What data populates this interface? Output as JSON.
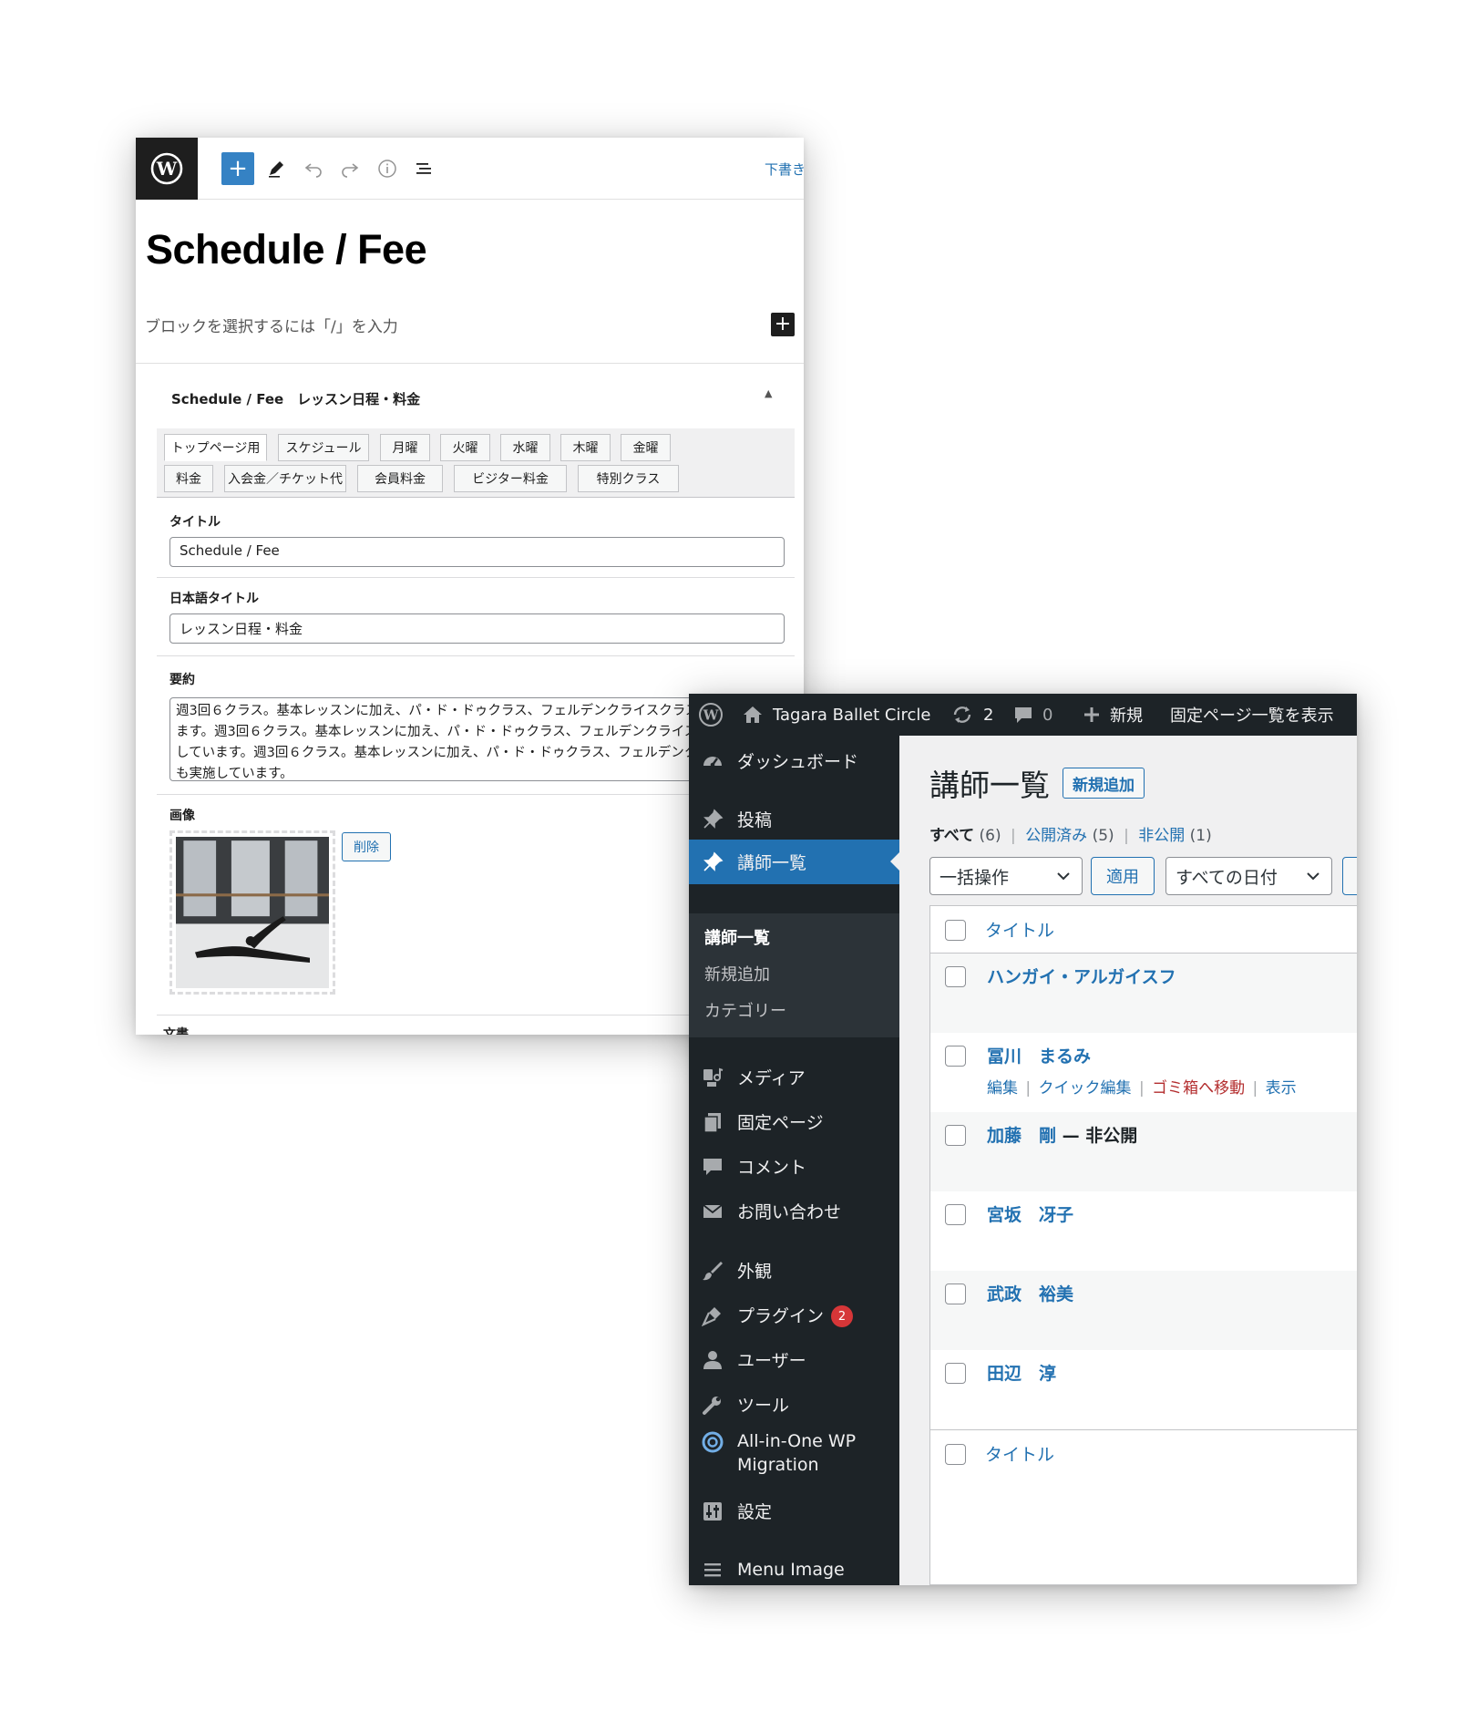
{
  "editor": {
    "toolbar": {
      "draft_label": "下書き"
    },
    "post_title": "Schedule / Fee",
    "block_hint": "ブロックを選択するには「/」を入力",
    "metabox": {
      "title": "Schedule / Fee　レッスン日程・料金",
      "tabs_row1": [
        "トップページ用",
        "スケジュール",
        "月曜",
        "火曜",
        "水曜",
        "木曜",
        "金曜"
      ],
      "tabs_row2": [
        "料金",
        "入会金／チケット代",
        "会員料金",
        "ビジター料金",
        "特別クラス"
      ],
      "active_tab": "トップページ用",
      "fields": {
        "title_label": "タイトル",
        "title_value": "Schedule / Fee",
        "jp_title_label": "日本語タイトル",
        "jp_title_value": "レッスン日程・料金",
        "summary_label": "要約",
        "summary_value": "週3回６クラス。基本レッスンに加え、パ・ド・ドゥクラス、フェルデンクライスクラスも実施しています。週3回６クラス。基本レッスンに加え、パ・ド・ドゥクラス、フェルデンクライスクラスも実施しています。週3回６クラス。基本レッスンに加え、パ・ド・ドゥクラス、フェルデンクライスクラスも実施しています。",
        "image_label": "画像",
        "delete_button": "削除",
        "document_label": "文書"
      }
    }
  },
  "admin": {
    "admin_bar": {
      "site_name": "Tagara Ballet Circle",
      "updates_count": "2",
      "comments_count": "0",
      "new_label": "新規",
      "view_label": "固定ページ一覧を表示"
    },
    "menu": {
      "dashboard": "ダッシュボード",
      "posts": "投稿",
      "current": "講師一覧",
      "submenu": [
        "講師一覧",
        "新規追加",
        "カテゴリー"
      ],
      "media": "メディア",
      "pages": "固定ページ",
      "comments": "コメント",
      "contact": "お問い合わせ",
      "appearance": "外観",
      "plugins": "プラグイン",
      "plugins_badge": "2",
      "users": "ユーザー",
      "tools": "ツール",
      "migration": "All-in-One WP",
      "migration_line2": "Migration",
      "settings": "設定",
      "menu_image": "Menu Image"
    },
    "page": {
      "heading": "講師一覧",
      "add_new": "新規追加",
      "views": {
        "all": "すべて",
        "all_count": "(6)",
        "published": "公開済み",
        "published_count": "(5)",
        "private": "非公開",
        "private_count": "(1)",
        "sep": "|"
      },
      "bulk_action": "一括操作",
      "apply": "適用",
      "date_filter": "すべての日付",
      "column_title": "タイトル",
      "rows": [
        {
          "title": "ハンガイ・アルガイスフ"
        },
        {
          "title": "冨川　まるみ"
        },
        {
          "title": "加藤　剛",
          "state": " — 非公開"
        },
        {
          "title": "宮坂　冴子"
        },
        {
          "title": "武政　裕美"
        },
        {
          "title": "田辺　淳"
        }
      ],
      "row_actions": {
        "edit": "編集",
        "quick_edit": "クイック編集",
        "trash": "ゴミ箱へ移動",
        "view": "表示",
        "sep": "|"
      }
    }
  }
}
